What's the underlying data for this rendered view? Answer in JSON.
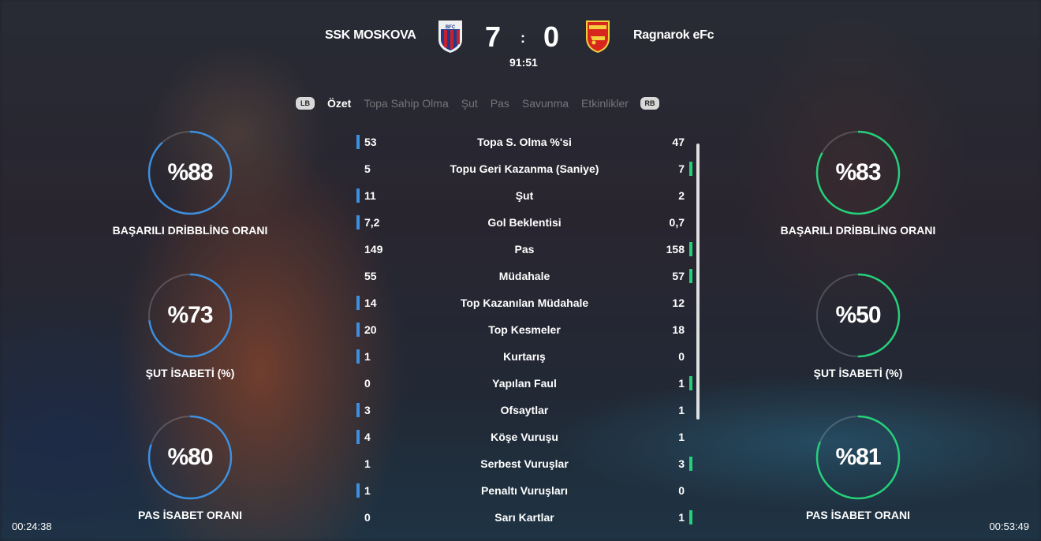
{
  "header": {
    "home_team": "SSK MOSKOVA",
    "away_team": "Ragnarok eFc",
    "home_score": "7",
    "away_score": "0",
    "separator": ":",
    "match_clock": "91:51",
    "home_crest_colors": [
      "#1e3c8c",
      "#c8202e"
    ],
    "away_crest_color": "#d7261e"
  },
  "tabs": {
    "left_button": "LB",
    "right_button": "RB",
    "items": [
      "Özet",
      "Topa Sahip Olma",
      "Şut",
      "Pas",
      "Savunma",
      "Etkinlikler"
    ],
    "active_index": 0
  },
  "stats": [
    {
      "home": "53",
      "label": "Topa S. Olma %'si",
      "away": "47",
      "lead": "home"
    },
    {
      "home": "5",
      "label": "Topu Geri Kazanma (Saniye)",
      "away": "7",
      "lead": "away"
    },
    {
      "home": "11",
      "label": "Şut",
      "away": "2",
      "lead": "home"
    },
    {
      "home": "7,2",
      "label": "Gol Beklentisi",
      "away": "0,7",
      "lead": "home"
    },
    {
      "home": "149",
      "label": "Pas",
      "away": "158",
      "lead": "away"
    },
    {
      "home": "55",
      "label": "Müdahale",
      "away": "57",
      "lead": "away"
    },
    {
      "home": "14",
      "label": "Top Kazanılan Müdahale",
      "away": "12",
      "lead": "home"
    },
    {
      "home": "20",
      "label": "Top Kesmeler",
      "away": "18",
      "lead": "home"
    },
    {
      "home": "1",
      "label": "Kurtarış",
      "away": "0",
      "lead": "home"
    },
    {
      "home": "0",
      "label": "Yapılan Faul",
      "away": "1",
      "lead": "away"
    },
    {
      "home": "3",
      "label": "Ofsaytlar",
      "away": "1",
      "lead": "home"
    },
    {
      "home": "4",
      "label": "Köşe Vuruşu",
      "away": "1",
      "lead": "home"
    },
    {
      "home": "1",
      "label": "Serbest Vuruşlar",
      "away": "3",
      "lead": "away"
    },
    {
      "home": "1",
      "label": "Penaltı Vuruşları",
      "away": "0",
      "lead": "home"
    },
    {
      "home": "0",
      "label": "Sarı Kartlar",
      "away": "1",
      "lead": "away"
    }
  ],
  "rings": {
    "home": [
      {
        "text": "%88",
        "value": 0.88,
        "label": "BAŞARILI DRİBBLİNG ORANI"
      },
      {
        "text": "%73",
        "value": 0.73,
        "label": "ŞUT İSABETİ (%)"
      },
      {
        "text": "%80",
        "value": 0.8,
        "label": "PAS İSABET ORANI"
      }
    ],
    "away": [
      {
        "text": "%83",
        "value": 0.83,
        "label": "BAŞARILI DRİBBLİNG ORANI"
      },
      {
        "text": "%50",
        "value": 0.5,
        "label": "ŞUT İSABETİ (%)"
      },
      {
        "text": "%81",
        "value": 0.81,
        "label": "PAS İSABET ORANI"
      }
    ]
  },
  "colors": {
    "home_accent": "#3d8fe0",
    "away_accent": "#25d07a",
    "ring_track": "rgba(255,255,255,0.18)"
  },
  "video": {
    "elapsed": "00:24:38",
    "total": "00:53:49"
  }
}
